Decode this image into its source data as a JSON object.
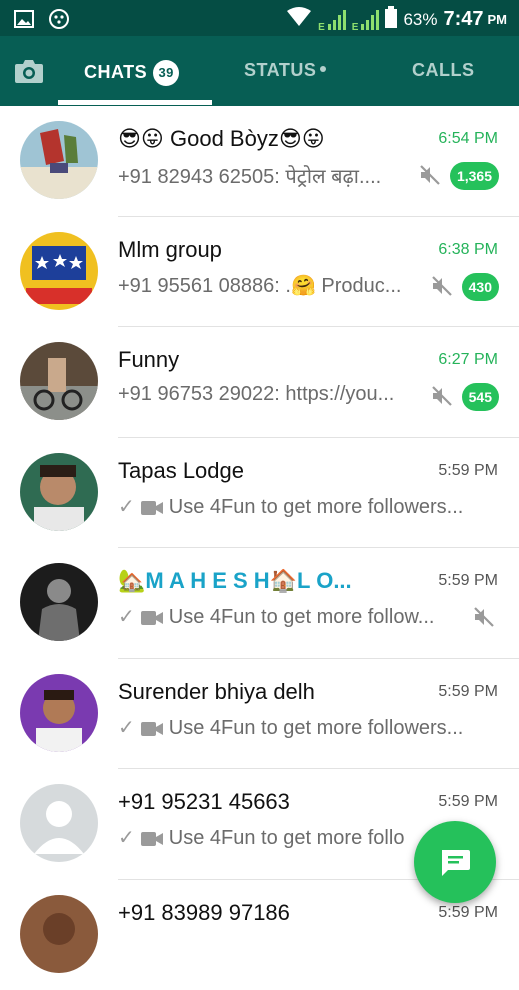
{
  "status_bar": {
    "battery": "63%",
    "time": "7:47",
    "ampm": "PM",
    "network_a": "E",
    "network_b": "E"
  },
  "tabs": {
    "camera_icon": "camera-icon",
    "chats": "CHATS",
    "chats_badge": "39",
    "status": "STATUS",
    "calls": "CALLS"
  },
  "colors": {
    "header": "#075e54",
    "statusbar": "#054d44",
    "accent": "#25c15b",
    "unread_time": "#25b35a"
  },
  "chats": [
    {
      "name": "😎😛 Good Bòyz😎😛",
      "preview": "+91 82943 62505: पेट्रोल बढ़ा....",
      "time": "6:54 PM",
      "unread": "1,365",
      "muted": true
    },
    {
      "name": "Mlm group",
      "preview": "+91 95561 08886: .🤗 Produc...",
      "time": "6:38 PM",
      "unread": "430",
      "muted": true
    },
    {
      "name": "Funny",
      "preview": "+91 96753 29022: https://you...",
      "time": "6:27 PM",
      "unread": "545",
      "muted": true
    },
    {
      "name": "Tapas Lodge",
      "preview": "Use 4Fun to get more followers...",
      "time": "5:59 PM"
    },
    {
      "name": "🏡M A H E S H🏠L O...",
      "preview": "Use 4Fun to get more follow...",
      "time": "5:59 PM",
      "muted": true
    },
    {
      "name": "Surender bhiya delh",
      "preview": "Use 4Fun to get more followers...",
      "time": "5:59 PM"
    },
    {
      "name": "+91 95231 45663",
      "preview": "Use 4Fun to get more follo",
      "time": "5:59 PM"
    },
    {
      "name": "+91 83989 97186",
      "preview": "",
      "time": "5:59 PM"
    }
  ],
  "fab": {
    "icon": "new-chat-icon"
  }
}
